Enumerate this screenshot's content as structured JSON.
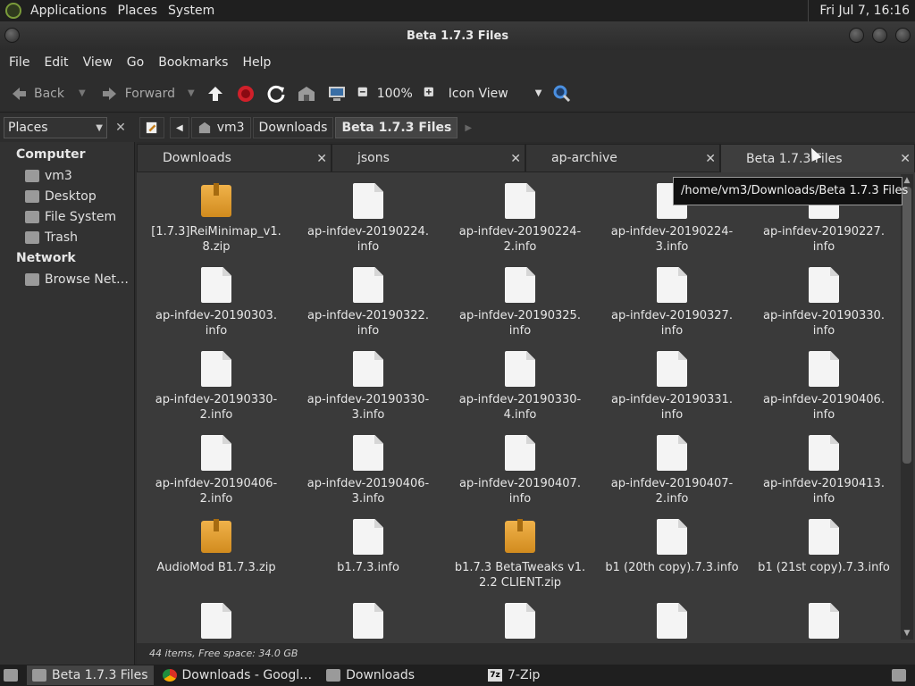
{
  "top_panel": {
    "menus": [
      "Applications",
      "Places",
      "System"
    ],
    "clock": "Fri Jul  7, 16:16"
  },
  "window": {
    "title": "Beta 1.7.3 Files"
  },
  "menubar": [
    "File",
    "Edit",
    "View",
    "Go",
    "Bookmarks",
    "Help"
  ],
  "toolbar": {
    "back": "Back",
    "forward": "Forward",
    "zoom": "100%",
    "view_mode": "Icon View"
  },
  "sidebar": {
    "combo": "Places",
    "sections": [
      {
        "title": "Computer",
        "items": [
          "vm3",
          "Desktop",
          "File System",
          "Trash"
        ]
      },
      {
        "title": "Network",
        "items": [
          "Browse Net…"
        ]
      }
    ]
  },
  "path": [
    "vm3",
    "Downloads",
    "Beta 1.7.3 Files"
  ],
  "tabs": [
    "Downloads",
    "jsons",
    "ap-archive",
    "Beta 1.7.3 Files"
  ],
  "files": [
    {
      "name": "[1.7.3]ReiMinimap_v1.\n8.zip",
      "type": "zip"
    },
    {
      "name": "ap-infdev-20190224.\ninfo",
      "type": "doc"
    },
    {
      "name": "ap-infdev-20190224-\n2.info",
      "type": "doc"
    },
    {
      "name": "ap-infdev-20190224-\n3.info",
      "type": "doc"
    },
    {
      "name": "ap-infdev-20190227.\ninfo",
      "type": "doc"
    },
    {
      "name": "ap-infdev-20190303.\ninfo",
      "type": "doc"
    },
    {
      "name": "ap-infdev-20190322.\ninfo",
      "type": "doc"
    },
    {
      "name": "ap-infdev-20190325.\ninfo",
      "type": "doc"
    },
    {
      "name": "ap-infdev-20190327.\ninfo",
      "type": "doc"
    },
    {
      "name": "ap-infdev-20190330.\ninfo",
      "type": "doc"
    },
    {
      "name": "ap-infdev-20190330-\n2.info",
      "type": "doc"
    },
    {
      "name": "ap-infdev-20190330-\n3.info",
      "type": "doc"
    },
    {
      "name": "ap-infdev-20190330-\n4.info",
      "type": "doc"
    },
    {
      "name": "ap-infdev-20190331.\ninfo",
      "type": "doc"
    },
    {
      "name": "ap-infdev-20190406.\ninfo",
      "type": "doc"
    },
    {
      "name": "ap-infdev-20190406-\n2.info",
      "type": "doc"
    },
    {
      "name": "ap-infdev-20190406-\n3.info",
      "type": "doc"
    },
    {
      "name": "ap-infdev-20190407.\ninfo",
      "type": "doc"
    },
    {
      "name": "ap-infdev-20190407-\n2.info",
      "type": "doc"
    },
    {
      "name": "ap-infdev-20190413.\ninfo",
      "type": "doc"
    },
    {
      "name": "AudioMod B1.7.3.zip",
      "type": "zip"
    },
    {
      "name": "b1.7.3.info",
      "type": "doc"
    },
    {
      "name": "b1.7.3 BetaTweaks v1.\n2.2 CLIENT.zip",
      "type": "zip"
    },
    {
      "name": "b1 (20th copy).7.3.info",
      "type": "doc"
    },
    {
      "name": "b1 (21st copy).7.3.info",
      "type": "doc"
    },
    {
      "name": "",
      "type": "doc"
    },
    {
      "name": "",
      "type": "doc"
    },
    {
      "name": "",
      "type": "doc"
    },
    {
      "name": "",
      "type": "doc"
    },
    {
      "name": "",
      "type": "doc"
    }
  ],
  "status": "44 items, Free space: 34.0 GB",
  "tooltip": "/home/vm3/Downloads/Beta 1.7.3 Files",
  "taskbar": [
    {
      "label": "Beta 1.7.3 Files",
      "icon": "folder-icon",
      "active": true
    },
    {
      "label": "Downloads - Googl…",
      "icon": "chrome-icon",
      "active": false
    },
    {
      "label": "Downloads",
      "icon": "folder-icon",
      "active": false
    },
    {
      "label": "7-Zip",
      "icon": "7zip-icon",
      "active": false
    }
  ],
  "colors": {
    "reload": "#ffffff",
    "stop": "#d0202a",
    "search": "#4a8fe0"
  }
}
